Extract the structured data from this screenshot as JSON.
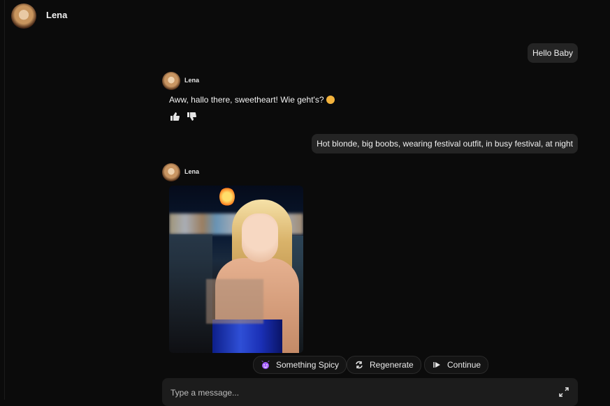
{
  "header": {
    "name": "Lena",
    "avatar_icon": "profile-photo"
  },
  "messages": [
    {
      "from": "user",
      "text": "Hello Baby"
    },
    {
      "from": "bot",
      "name": "Lena",
      "text": "Aww, hallo there, sweetheart! Wie geht's?"
    },
    {
      "from": "user",
      "text": "Hot blonde, big boobs, wearing festival outfit, in busy festival, at night"
    },
    {
      "from": "bot",
      "name": "Lena",
      "image_alt": "photo"
    }
  ],
  "reactions": {
    "like_icon": "thumbs-up-icon",
    "dislike_icon": "thumbs-down-icon"
  },
  "actions": {
    "spicy": {
      "label": "Something Spicy",
      "icon": "devil-icon",
      "color": "#a35bff"
    },
    "regenerate": {
      "label": "Regenerate",
      "icon": "refresh-icon"
    },
    "continue": {
      "label": "Continue",
      "icon": "play-icon"
    }
  },
  "composer": {
    "placeholder": "Type a message...",
    "expand_icon": "expand-icon"
  }
}
